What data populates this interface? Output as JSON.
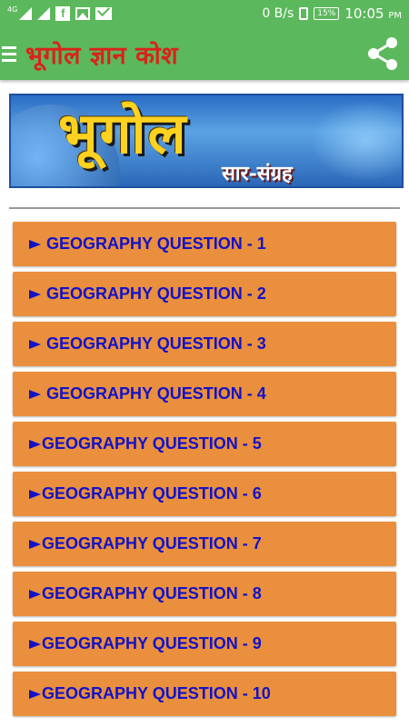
{
  "status_bar": {
    "network": "4G",
    "data_speed": "0 B/s",
    "battery": "15%",
    "time": "10:05",
    "ampm": "PM"
  },
  "app_bar": {
    "title": "भूगोल ज्ञान कोश"
  },
  "banner": {
    "title": "भूगोल",
    "subtitle": "सार-संग्रह"
  },
  "questions": [
    {
      "label": "GEOGRAPHY QUESTION - 1"
    },
    {
      "label": "GEOGRAPHY QUESTION - 2"
    },
    {
      "label": "GEOGRAPHY QUESTION - 3"
    },
    {
      "label": "GEOGRAPHY QUESTION - 4"
    },
    {
      "label": "GEOGRAPHY QUESTION - 5"
    },
    {
      "label": "GEOGRAPHY QUESTION - 6"
    },
    {
      "label": "GEOGRAPHY QUESTION - 7"
    },
    {
      "label": "GEOGRAPHY QUESTION - 8"
    },
    {
      "label": "GEOGRAPHY QUESTION - 9"
    },
    {
      "label": "GEOGRAPHY QUESTION - 10"
    }
  ],
  "icons": {
    "menu": "hamburger-menu-icon",
    "share": "share-icon"
  },
  "colors": {
    "app_bar": "#5cb85c",
    "title_text": "#d9231a",
    "list_item_bg": "#ea8f3d",
    "list_item_text": "#1212c8"
  }
}
